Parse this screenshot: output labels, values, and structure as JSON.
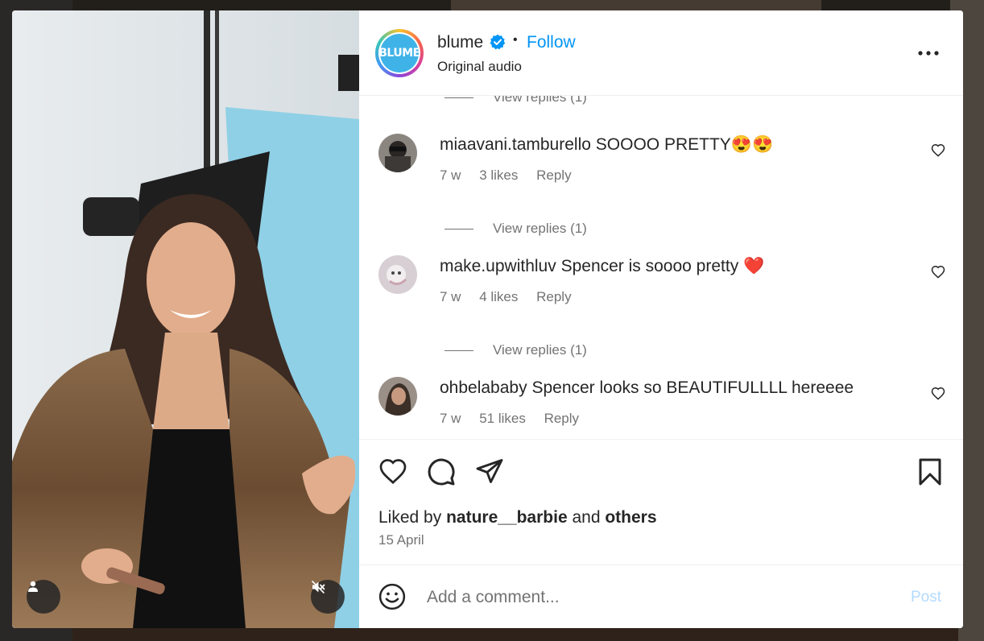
{
  "post": {
    "username": "blume",
    "verified": true,
    "follow_label": "Follow",
    "separator": "•",
    "audio": "Original audio",
    "avatar_text": "BLUME"
  },
  "comments": {
    "partial_view_replies": "View replies (1)",
    "items": [
      {
        "username": "miaavani.tamburello",
        "text": "SOOOO PRETTY😍😍",
        "age": "7 w",
        "likes": "3 likes",
        "reply_label": "Reply",
        "view_replies": "View replies (1)"
      },
      {
        "username": "make.upwithluv",
        "text": "Spencer is soooo pretty ❤️",
        "age": "7 w",
        "likes": "4 likes",
        "reply_label": "Reply",
        "view_replies": "View replies (1)"
      },
      {
        "username": "ohbelababy",
        "text": "Spencer looks so BEAUTIFULLLL hereeee",
        "age": "7 w",
        "likes": "51 likes",
        "reply_label": "Reply"
      }
    ]
  },
  "engagement": {
    "liked_prefix": "Liked by",
    "liked_user": "nature__barbie",
    "liked_and": "and",
    "liked_others": "others",
    "date": "15 April"
  },
  "comment_box": {
    "placeholder": "Add a comment...",
    "post_label": "Post"
  },
  "icons": {
    "header_more": "more-horizontal-icon",
    "verified": "verified-badge-icon",
    "like": "heart-icon",
    "comment": "comment-icon",
    "share": "send-icon",
    "save": "bookmark-icon",
    "emoji": "emoji-icon",
    "user_tag": "user-tag-icon",
    "mute": "speaker-muted-icon"
  },
  "colors": {
    "link": "#0095f6",
    "post_disabled": "#b3dbff",
    "secondary_text": "#737373",
    "primary_text": "#262626",
    "heart_red": "#e0142c"
  }
}
